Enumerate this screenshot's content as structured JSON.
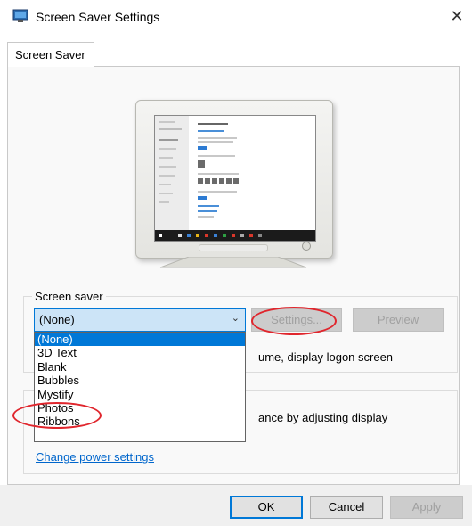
{
  "window": {
    "title": "Screen Saver Settings",
    "close_glyph": "✕"
  },
  "tab": {
    "label": "Screen Saver"
  },
  "group": {
    "label": "Screen saver",
    "selected_value": "(None)",
    "settings_label": "Settings...",
    "preview_label": "Preview",
    "wait_text": "ume, display logon screen",
    "options": [
      "(None)",
      "3D Text",
      "Blank",
      "Bubbles",
      "Mystify",
      "Photos",
      "Ribbons"
    ]
  },
  "power": {
    "partial_text": "ance by adjusting display",
    "link_label": "Change power settings"
  },
  "footer": {
    "ok_label": "OK",
    "cancel_label": "Cancel",
    "apply_label": "Apply"
  },
  "colors": {
    "accent": "#0078d7",
    "annotation": "#e0262d",
    "link": "#0066cc"
  },
  "icons": [
    "screen-saver-app-icon",
    "close-icon",
    "chevron-down-icon"
  ]
}
